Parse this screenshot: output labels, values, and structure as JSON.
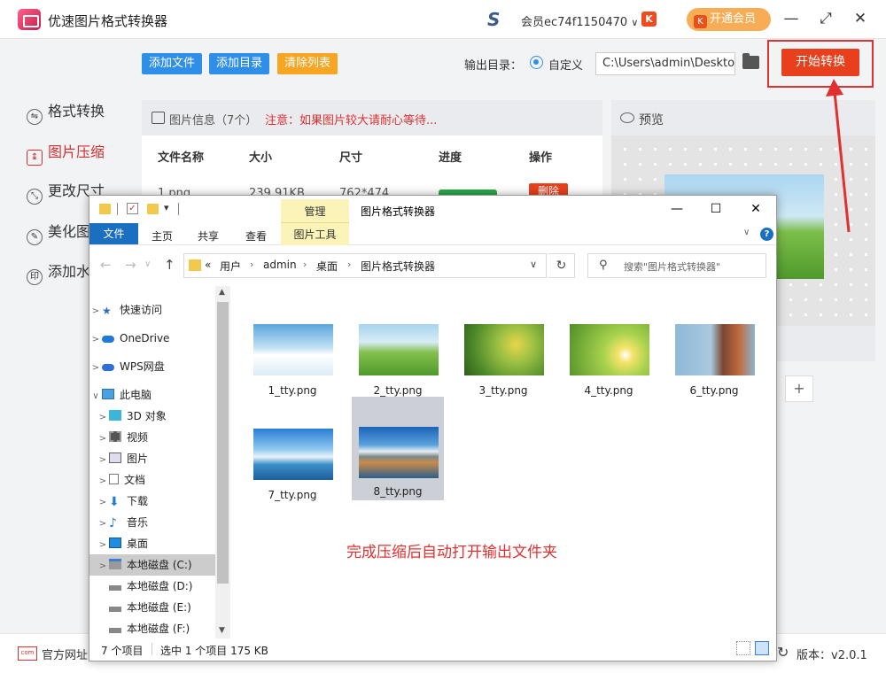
{
  "app": {
    "title": "优速图片格式转换器",
    "member": "会员ec74f1150470",
    "member_dropdown": "∨",
    "open_vip": "开通会员",
    "vip_badge": "K",
    "minimize": "—",
    "maximize": "⤢",
    "close": "✕"
  },
  "sidebar": {
    "items": [
      {
        "label": "格式转换",
        "icon": "⇋"
      },
      {
        "label": "图片压缩",
        "icon": "↨"
      },
      {
        "label": "更改尺寸",
        "icon": "⤡"
      },
      {
        "label": "美化图片",
        "icon": "✎"
      },
      {
        "label": "添加水印",
        "icon": "印"
      }
    ]
  },
  "toolbar": {
    "add_file": "添加文件",
    "add_dir": "添加目录",
    "clear_list": "清除列表",
    "output_dir_label": "输出目录：",
    "custom_label": "自定义",
    "output_path": "C:\\Users\\admin\\Desktop",
    "start": "开始转换"
  },
  "info": {
    "title": "图片信息（7个）",
    "notice": "注意：如果图片较大请耐心等待...",
    "columns": [
      "文件名称",
      "大小",
      "尺寸",
      "进度",
      "操作"
    ],
    "row": {
      "name": "1.png",
      "size": "239.91KB",
      "dims": "762*474",
      "action": "删除"
    }
  },
  "preview": {
    "title": "预览",
    "plus": "+"
  },
  "footer": {
    "site": "官方网址",
    "site_icon": "com",
    "version": "版本：v2.0.1",
    "refresh": "↻"
  },
  "explorer": {
    "manage": "管理",
    "image_tools": "图片工具",
    "title": "图片格式转换器",
    "tabs": [
      "文件",
      "主页",
      "共享",
      "查看"
    ],
    "help": "?",
    "nav": {
      "back": "←",
      "forward": "→",
      "up": "↑"
    },
    "breadcrumb": [
      "«",
      "用户",
      "admin",
      "桌面",
      "图片格式转换器"
    ],
    "search_placeholder": "搜索\"图片格式转换器\"",
    "tree": [
      {
        "label": "快速访问",
        "chev": ">"
      },
      {
        "label": "OneDrive",
        "chev": ">"
      },
      {
        "label": "WPS网盘",
        "chev": ">"
      },
      {
        "label": "此电脑",
        "chev": "∨"
      },
      {
        "label": "3D 对象",
        "chev": ">"
      },
      {
        "label": "视频",
        "chev": ">"
      },
      {
        "label": "图片",
        "chev": ">"
      },
      {
        "label": "文档",
        "chev": ">"
      },
      {
        "label": "下载",
        "chev": ">"
      },
      {
        "label": "音乐",
        "chev": ">"
      },
      {
        "label": "桌面",
        "chev": ">"
      },
      {
        "label": "本地磁盘 (C:)",
        "chev": ">"
      },
      {
        "label": "本地磁盘 (D:)",
        "chev": ""
      },
      {
        "label": "本地磁盘 (E:)",
        "chev": ""
      },
      {
        "label": "本地磁盘 (F:)",
        "chev": ""
      }
    ],
    "files": [
      "1_tty.png",
      "2_tty.png",
      "3_tty.png",
      "4_tty.png",
      "6_tty.png",
      "7_tty.png",
      "8_tty.png"
    ],
    "annotation": "完成压缩后自动打开输出文件夹",
    "status_count": "7 个项目",
    "status_selected": "选中 1 个项目  175 KB"
  }
}
